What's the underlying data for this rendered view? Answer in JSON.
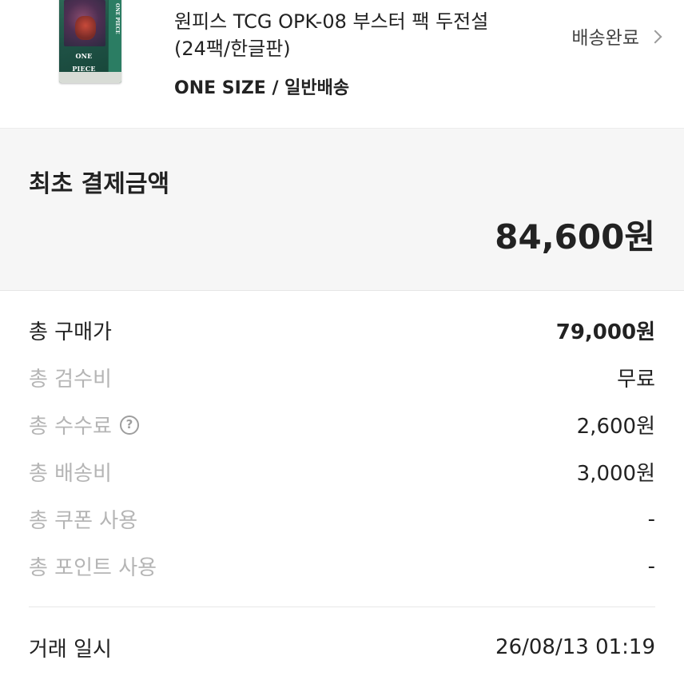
{
  "product": {
    "title": "원피스 TCG OPK-08 부스터 팩 두전설 (24팩/한글판)",
    "option": "ONE SIZE / 일반배송",
    "status": "배송완료",
    "thumbnail": {
      "logo_text": "ONE PIECE",
      "side_text": "ONE PIECE"
    }
  },
  "initial_payment": {
    "label": "최초 결제금액",
    "amount": "84,600원"
  },
  "breakdown": [
    {
      "label": "총 구매가",
      "value": "79,000원"
    },
    {
      "label": "총 검수비",
      "value": "무료"
    },
    {
      "label": "총 수수료",
      "value": "2,600원",
      "help_icon": "?"
    },
    {
      "label": "총 배송비",
      "value": "3,000원"
    },
    {
      "label": "총 쿠폰 사용",
      "value": "-"
    },
    {
      "label": "총 포인트 사용",
      "value": "-"
    }
  ],
  "transaction": {
    "label": "거래 일시",
    "datetime": "26/08/13 01:19"
  },
  "colors": {
    "text_primary": "#222222",
    "text_muted": "#b5b5b5",
    "section_background": "#f6f6f6",
    "box_green": "#1f5246"
  }
}
